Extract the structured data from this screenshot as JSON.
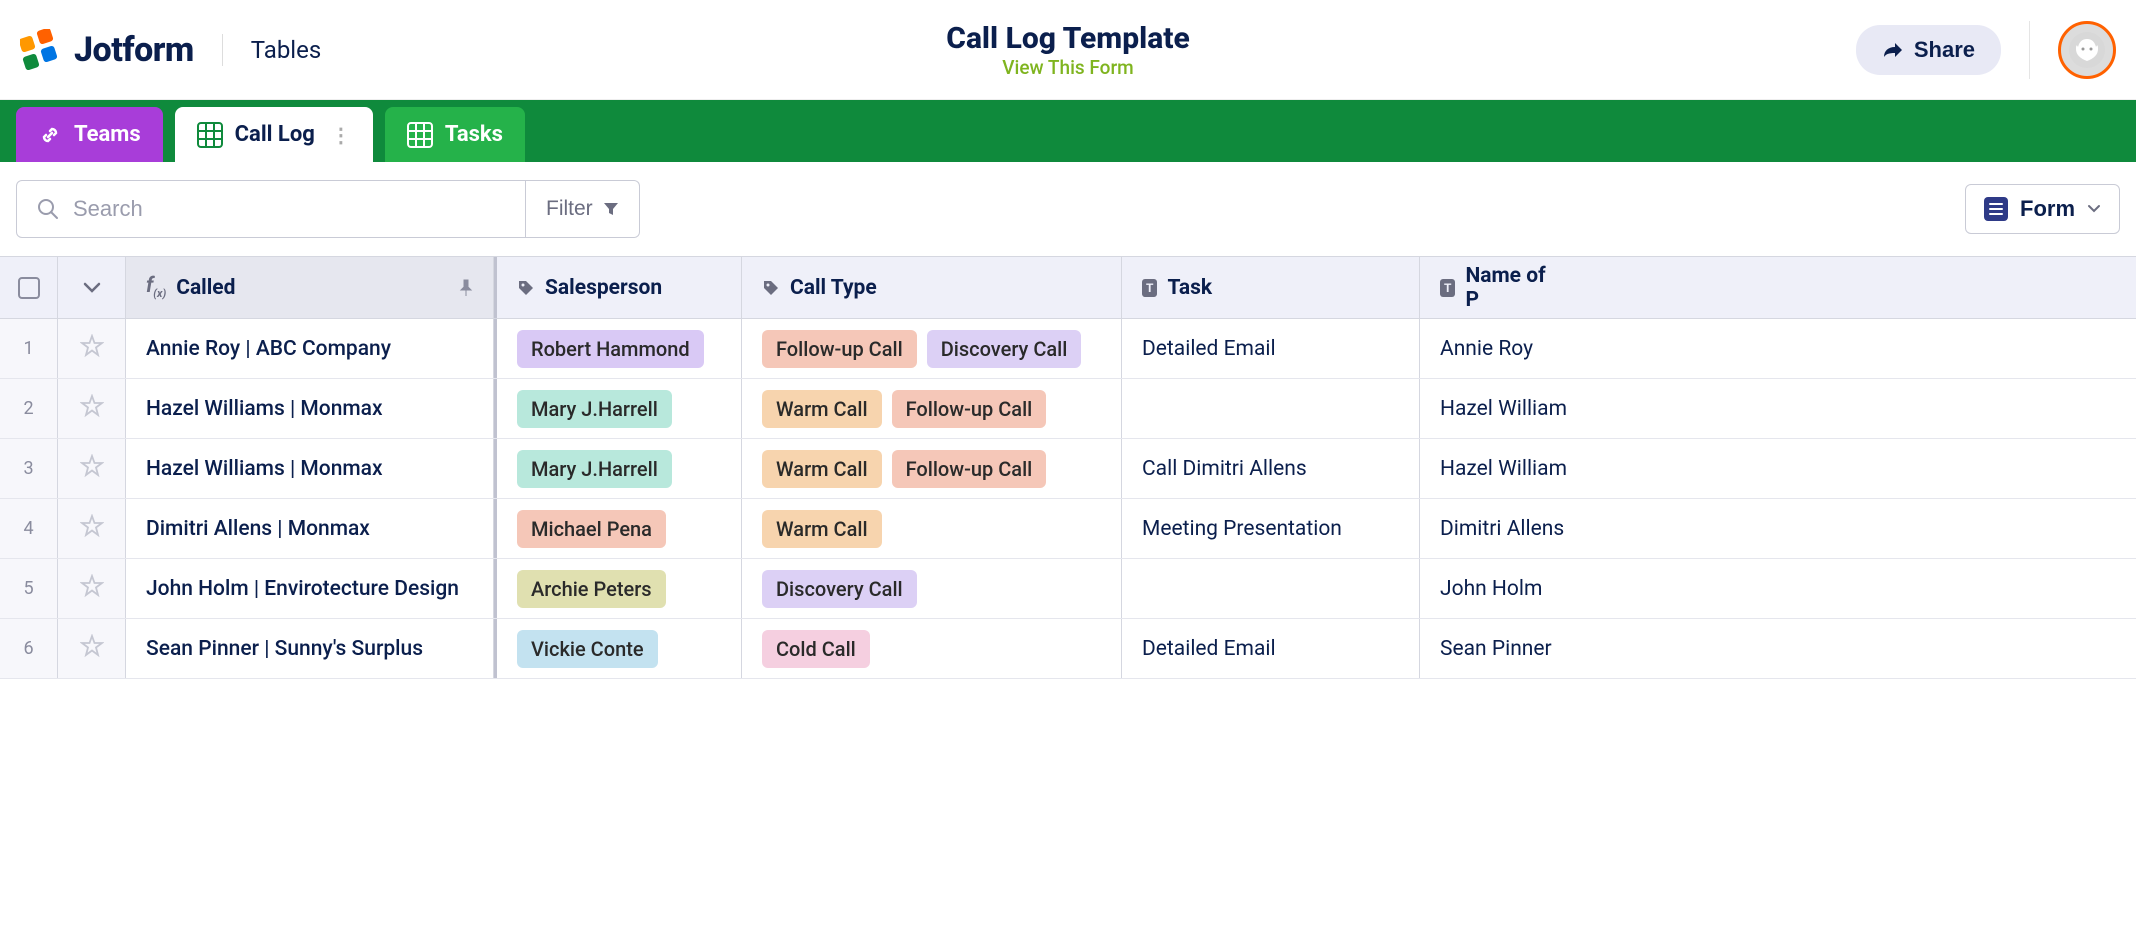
{
  "header": {
    "brand": "Jotform",
    "product": "Tables",
    "title": "Call Log Template",
    "view_link": "View This Form",
    "share": "Share"
  },
  "tabs": {
    "teams": "Teams",
    "call_log": "Call Log",
    "tasks": "Tasks"
  },
  "toolbar": {
    "search_placeholder": "Search",
    "filter": "Filter",
    "form": "Form"
  },
  "columns": {
    "called": "Called",
    "salesperson": "Salesperson",
    "call_type": "Call Type",
    "task": "Task",
    "name": "Name of P"
  },
  "tag_colors": {
    "Robert Hammond": "tag-purple",
    "Mary J.Harrell": "tag-teal",
    "Michael Pena": "tag-salmon",
    "Archie Peters": "tag-olive",
    "Vickie Conte": "tag-blue",
    "Follow-up Call": "tag-coral",
    "Discovery Call": "tag-lav",
    "Warm Call": "tag-peach",
    "Cold Call": "tag-pink"
  },
  "rows": [
    {
      "num": "1",
      "called": "Annie Roy | ABC Company",
      "salesperson": "Robert Hammond",
      "call_types": [
        "Follow-up Call",
        "Discovery Call"
      ],
      "task": "Detailed Email",
      "name": "Annie Roy"
    },
    {
      "num": "2",
      "called": "Hazel Williams | Monmax",
      "salesperson": "Mary J.Harrell",
      "call_types": [
        "Warm Call",
        "Follow-up Call"
      ],
      "task": "",
      "name": "Hazel William"
    },
    {
      "num": "3",
      "called": "Hazel Williams | Monmax",
      "salesperson": "Mary J.Harrell",
      "call_types": [
        "Warm Call",
        "Follow-up Call"
      ],
      "task": "Call Dimitri Allens",
      "name": "Hazel William"
    },
    {
      "num": "4",
      "called": "Dimitri Allens | Monmax",
      "salesperson": "Michael Pena",
      "call_types": [
        "Warm Call"
      ],
      "task": "Meeting Presentation",
      "name": "Dimitri Allens"
    },
    {
      "num": "5",
      "called": "John Holm | Envirotecture Design",
      "salesperson": "Archie Peters",
      "call_types": [
        "Discovery Call"
      ],
      "task": "",
      "name": "John Holm"
    },
    {
      "num": "6",
      "called": "Sean Pinner | Sunny's Surplus",
      "salesperson": "Vickie Conte",
      "call_types": [
        "Cold Call"
      ],
      "task": "Detailed Email",
      "name": "Sean Pinner"
    }
  ]
}
